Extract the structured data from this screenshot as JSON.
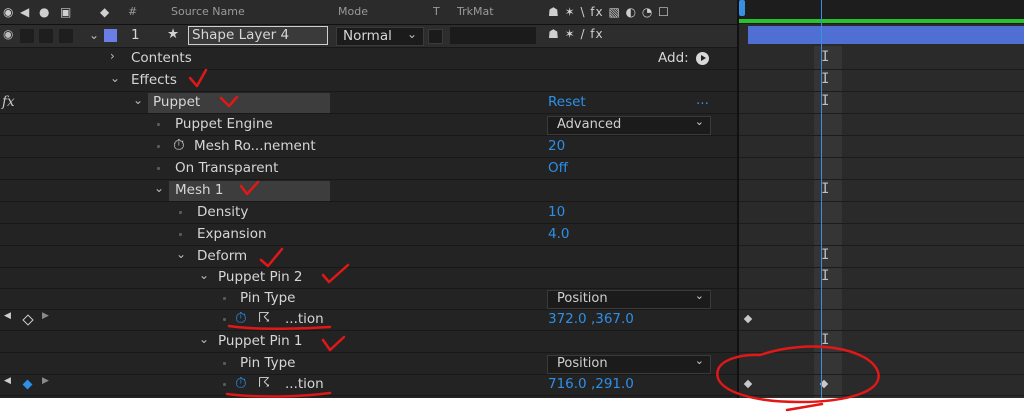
{
  "header": {
    "hash": "#",
    "source_name": "Source Name",
    "mode": "Mode",
    "t": "T",
    "trkmat": "TrkMat",
    "switch_icons": "☗ ✶ \\ fx ▧ ◐ ◔ ☐"
  },
  "layer": {
    "number": "1",
    "name": "Shape Layer 4",
    "mode": "Normal",
    "switches": "☗ ✶ / fx"
  },
  "rows": {
    "contents": "Contents",
    "add_label": "Add:",
    "effects": "Effects",
    "fx_badge": "fx",
    "puppet": "Puppet",
    "reset": "Reset",
    "more": "...",
    "puppet_engine": "Puppet Engine",
    "puppet_engine_value": "Advanced",
    "mesh_refinement": "Mesh Ro...nement",
    "mesh_refinement_value": "20",
    "on_transparent": "On Transparent",
    "on_transparent_value": "Off",
    "mesh1": "Mesh 1",
    "density": "Density",
    "density_value": "10",
    "expansion": "Expansion",
    "expansion_value": "4.0",
    "deform": "Deform",
    "pin2": "Puppet Pin 2",
    "pin2_type": "Pin Type",
    "pin2_type_value": "Position",
    "pin2_position": "...tion",
    "pin2_position_value": "372.0 ,367.0",
    "pin1": "Puppet Pin 1",
    "pin1_type": "Pin Type",
    "pin1_type_value": "Position",
    "pin1_position": "...tion",
    "pin1_position_value": "716.0 ,291.0"
  },
  "colors": {
    "value_blue": "#2e8fe8",
    "layer_label": "#6b7ee8",
    "annotation_red": "#e01818",
    "work_area_green": "#29c12f",
    "playhead_blue": "#3a8fe0"
  }
}
